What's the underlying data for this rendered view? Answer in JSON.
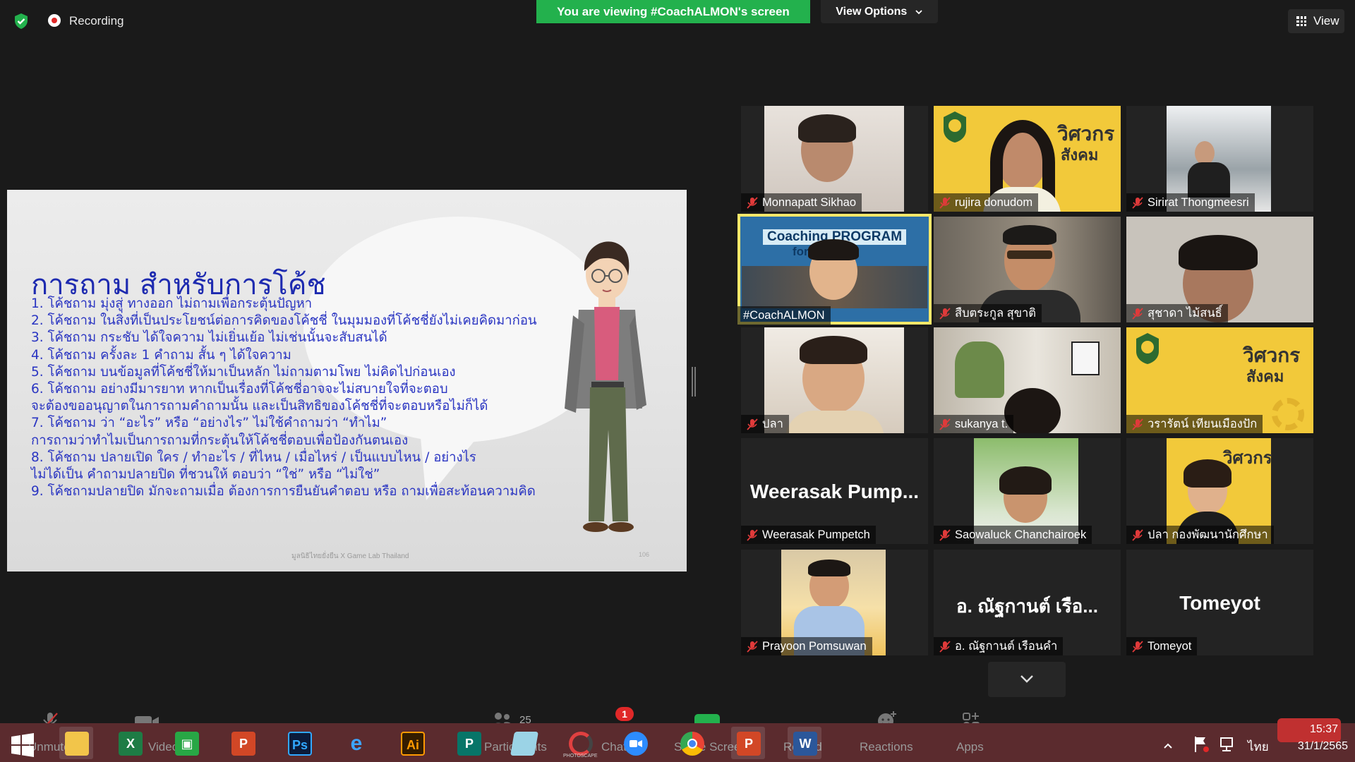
{
  "top": {
    "recording_label": "Recording",
    "viewing_banner": "You are viewing #CoachALMON's screen",
    "view_options_label": "View Options",
    "view_label": "View"
  },
  "slide": {
    "title": "การถาม สำหรับการโค้ช",
    "lines": [
      "1. โค้ชถาม มุ่งสู่ ทางออก ไม่ถามเพื่อกระตุ้นปัญหา",
      "2. โค้ชถาม ในสิ่งที่เป็นประโยชน์ต่อการคิดของโค้ชชี่ ในมุมมองที่โค้ชชี่ยังไม่เคยคิดมาก่อน",
      "3. โค้ชถาม กระชับ ได้ใจความ ไม่เยิ่นเย้อ ไม่เช่นนั้นจะสับสนได้",
      "4. โค้ชถาม ครั้งละ 1 คำถาม สั้น ๆ ได้ใจความ",
      "5. โค้ชถาม บนข้อมูลที่โค้ชชี่ให้มาเป็นหลัก ไม่ถามตามโพย ไม่คิดไปก่อนเอง",
      "6. โค้ชถาม อย่างมีมารยาท หากเป็นเรื่องที่โค้ชชี่อาจจะไม่สบายใจที่จะตอบ",
      "    จะต้องขออนุญาตในการถามคำถามนั้น และเป็นสิทธิของโค้ชชี่ที่จะตอบหรือไม่ก็ได้",
      "7. โค้ชถาม ว่า “อะไร” หรือ “อย่างไร” ไม่ใช้คำถามว่า “ทำไม”",
      "    การถามว่าทำไมเป็นการถามที่กระตุ้นให้โค้ชชี่ตอบเพื่อป้องกันตนเอง",
      "8. โค้ชถาม ปลายเปิด ใคร / ทำอะไร / ที่ไหน / เมื่อไหร่ / เป็นแบบไหน / อย่างไร",
      "    ไม่ได้เป็น คำถามปลายปิด ที่ชวนให้ ตอบว่า “ใช่” หรือ “ไม่ใช่”",
      "9. โค้ชถามปลายปิด มักจะถามเมื่อ ต้องการการยืนยันคำตอบ หรือ ถามเพื่อสะท้อนความคิด"
    ],
    "footer": "มูลนิธิไทยยั่งยืน X Game Lab Thailand",
    "page_number": "106"
  },
  "participants": [
    {
      "name": "Monnapatt Sikhao"
    },
    {
      "name": "rujira donudom"
    },
    {
      "name": "Sirirat Thongmeesri"
    },
    {
      "name": "#CoachALMON"
    },
    {
      "name": "สืบตระกูล สุขาติ"
    },
    {
      "name": "สุชาดา ไม้สนธิ์"
    },
    {
      "name": "ปลา"
    },
    {
      "name": "sukanya t."
    },
    {
      "name": "วรารัตน์ เทียนเมืองปัก"
    },
    {
      "name": "Weerasak Pumpetch",
      "big": "Weerasak  Pump..."
    },
    {
      "name": "Saowaluck Chanchairoek"
    },
    {
      "name": "ปลา กองพัฒนานักศึกษา"
    },
    {
      "name": "Prayoon Pomsuwan"
    },
    {
      "name": "อ. ณัฐกานต์  เรือนคำ",
      "big": "อ. ณัฐกานต์  เรือ..."
    },
    {
      "name": "Tomeyot",
      "big": "Tomeyot"
    }
  ],
  "slide_overlay": {
    "coaching_banner": "Coaching PROGRAM",
    "coaching_banner_2": "for Trainer",
    "poster_text": "วิศวกร",
    "poster_text_2": "สังคม"
  },
  "toolbar": {
    "unmute": "Unmute",
    "video": "Video",
    "participants": "Participants",
    "participants_count": "25",
    "chat": "Chat",
    "chat_badge": "1",
    "share": "Share Screen",
    "record": "Record",
    "reactions": "Reactions",
    "apps": "Apps"
  },
  "taskbar": {
    "app_ai": "Ai",
    "app_ps": "Ps",
    "ime": "ไทย",
    "time": "15:37",
    "date": "31/1/2565",
    "photoscape_label": "PHOTOSCAPE"
  },
  "colors": {
    "banner_green": "#23b14d",
    "slide_text": "#2a35c2",
    "active_speaker": "#f4e86a",
    "taskbar": "#5b2b2e"
  }
}
